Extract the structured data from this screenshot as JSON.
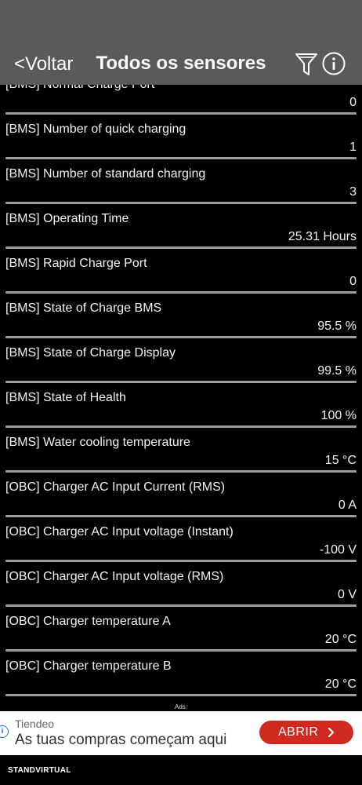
{
  "nav": {
    "back_label": "<Voltar",
    "title": "Todos os sensores",
    "filter_icon": "filter-icon",
    "info_icon": "info-icon"
  },
  "sensors": [
    {
      "label": "[BMS] Normal Charge Port",
      "value": "0"
    },
    {
      "label": "[BMS] Number of quick charging",
      "value": "1"
    },
    {
      "label": "[BMS] Number of standard charging",
      "value": "3"
    },
    {
      "label": "[BMS] Operating Time",
      "value": "25.31 Hours"
    },
    {
      "label": "[BMS] Rapid Charge Port",
      "value": "0"
    },
    {
      "label": "[BMS] State of Charge BMS",
      "value": "95.5 %"
    },
    {
      "label": "[BMS] State of Charge Display",
      "value": "99.5 %"
    },
    {
      "label": "[BMS] State of Health",
      "value": "100 %"
    },
    {
      "label": "[BMS] Water cooling temperature",
      "value": "15 °C"
    },
    {
      "label": "[OBC] Charger AC Input Current (RMS)",
      "value": "0 A"
    },
    {
      "label": "[OBC] Charger AC Input voltage (Instant)",
      "value": "-100 V"
    },
    {
      "label": "[OBC] Charger AC Input voltage (RMS)",
      "value": "0 V"
    },
    {
      "label": "[OBC] Charger temperature A",
      "value": "20 °C"
    },
    {
      "label": "[OBC] Charger temperature B",
      "value": "20 °C"
    }
  ],
  "ads": {
    "label": "Ads:",
    "brand": "Tiendeo",
    "text": "As tuas compras começam aqui",
    "cta": "ABRIR"
  },
  "watermark": "STANDVIRTUAL",
  "colors": {
    "nav_bg": "#5a5a5a",
    "separator": "#9d9d9d",
    "cta_bg": "#d02a20"
  }
}
